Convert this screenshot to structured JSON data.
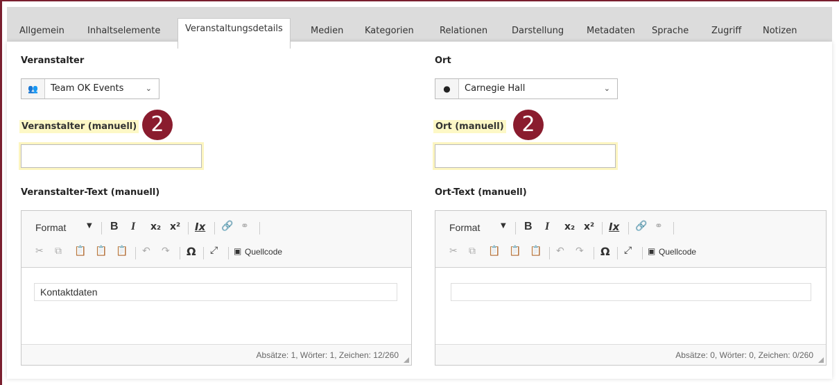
{
  "tabs": [
    {
      "label": "Allgemein"
    },
    {
      "label": "Inhaltselemente"
    },
    {
      "label": "Veranstaltungsdetails"
    },
    {
      "label": "Medien"
    },
    {
      "label": "Kategorien"
    },
    {
      "label": "Relationen"
    },
    {
      "label": "Darstellung"
    },
    {
      "label": "Metadaten"
    },
    {
      "label": "Sprache"
    },
    {
      "label": "Zugriff"
    },
    {
      "label": "Notizen"
    }
  ],
  "left": {
    "select_label": "Veranstalter",
    "select_value": "Team OK Events",
    "select_icon": "users-icon",
    "manual_label": "Veranstalter (manuell)",
    "manual_value": "",
    "badge": "2",
    "text_label": "Veranstalter-Text (manuell)",
    "editor_content": "Kontaktdaten",
    "status": "Absätze: 1, Wörter: 1, Zeichen: 12/260"
  },
  "right": {
    "select_label": "Ort",
    "select_value": "Carnegie Hall",
    "select_icon": "map-marker-icon",
    "manual_label": "Ort (manuell)",
    "manual_value": "",
    "badge": "2",
    "text_label": "Ort-Text (manuell)",
    "editor_content": "",
    "status": "Absätze: 0, Wörter: 0, Zeichen: 0/260"
  },
  "toolbar": {
    "format": "Format",
    "bold": "B",
    "italic": "I",
    "subscript": "x₂",
    "superscript": "x²",
    "remove_format": "Ix",
    "special_char": "Ω",
    "source": "Quellcode"
  },
  "colors": {
    "accent": "#8a1c2e",
    "highlight": "#fdf8c6",
    "tabbar": "#dcdcdc"
  }
}
